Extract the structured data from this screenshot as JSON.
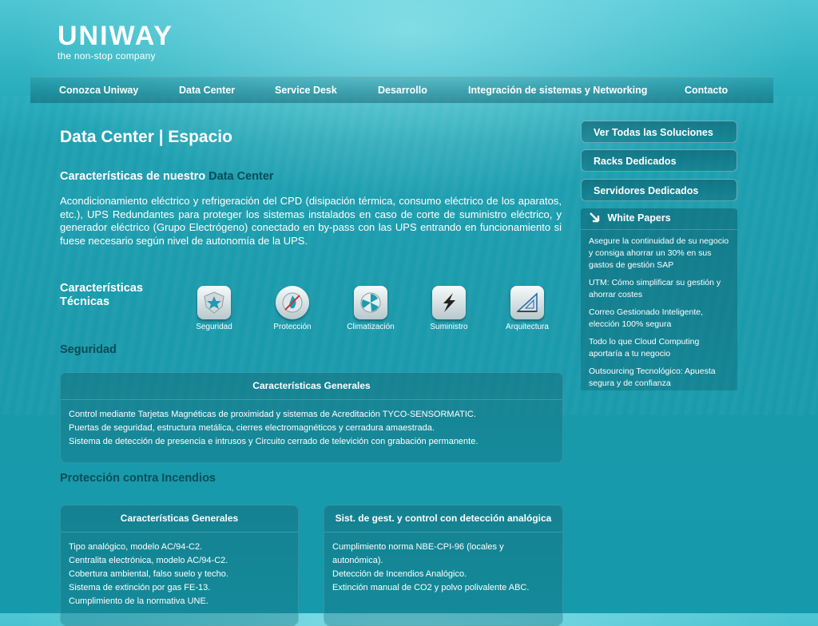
{
  "brand": {
    "logo": "UNIWAY",
    "tagline": "the non-stop company"
  },
  "nav": [
    "Conozca Uniway",
    "Data Center",
    "Service Desk",
    "Desarrollo",
    "Integración de sistemas y Networking",
    "Contacto"
  ],
  "page": {
    "title": "Data Center | Espacio",
    "subtitle_prefix": "Características de nuestro",
    "subtitle_highlight": "Data Center",
    "intro": "Acondicionamiento eléctrico y refrigeración del CPD (disipación térmica, consumo eléctrico de los aparatos, etc.), UPS Redundantes para proteger los sistemas instalados en caso de corte de suministro eléctrico, y generador eléctrico (Grupo Electrógeno) conectado en by-pass con las UPS entrando en funcionamiento si fuese necesario según nivel de autonomía de la UPS."
  },
  "tech": {
    "title": "Características Técnicas",
    "items": [
      "Seguridad",
      "Protección",
      "Climatización",
      "Suministro",
      "Arquitectura"
    ]
  },
  "seguridad": {
    "title": "Seguridad",
    "box_title": "Características Generales",
    "items": [
      "Control mediante Tarjetas Magnéticas de proximidad y sistemas de Acreditación TYCO-SENSORMATIC.",
      "Puertas de seguridad, estructura metálica, cierres electromagnéticos y cerradura amaestrada.",
      "Sistema de detección de presencia e intrusos y Circuito cerrado de televición con grabación permanente."
    ]
  },
  "incendios": {
    "title": "Protección contra Incendios",
    "box1_title": "Características Generales",
    "box1_items": [
      "Tipo analógico, modelo AC/94-C2.",
      "Centralita electrónica, modelo AC/94-C2.",
      "Cobertura ambiental, falso suelo y techo.",
      "Sistema de extinción por gas FE-13.",
      "Cumplimiento de la normativa UNE."
    ],
    "box2_title": "Sist. de gest. y control con detección analógica",
    "box2_items": [
      "Cumplimiento norma NBE-CPI-96 (locales y",
      "autonómica).",
      "Detección de Incendios Analógico.",
      "Extinción manual de CO2 y polvo polivalente ABC."
    ]
  },
  "sidebar": {
    "buttons": [
      "Ver Todas las Soluciones",
      "Racks Dedicados",
      "Servidores Dedicados"
    ],
    "white_papers_title": "White Papers",
    "white_papers": [
      "Asegure la continuidad de su negocio y consiga ahorrar un 30% en sus gastos de gestión SAP",
      "UTM: Cómo simplificar su gestión y ahorrar costes",
      "Correo Gestionado Inteligente, elección 100% segura",
      "Todo lo que Cloud Computing aportaría a tu negocio",
      "Outsourcing Tecnológico: Apuesta segura y de confianza"
    ]
  },
  "colors": {
    "accent_dark": "#0c4c58",
    "bg": "#1a9aab"
  }
}
